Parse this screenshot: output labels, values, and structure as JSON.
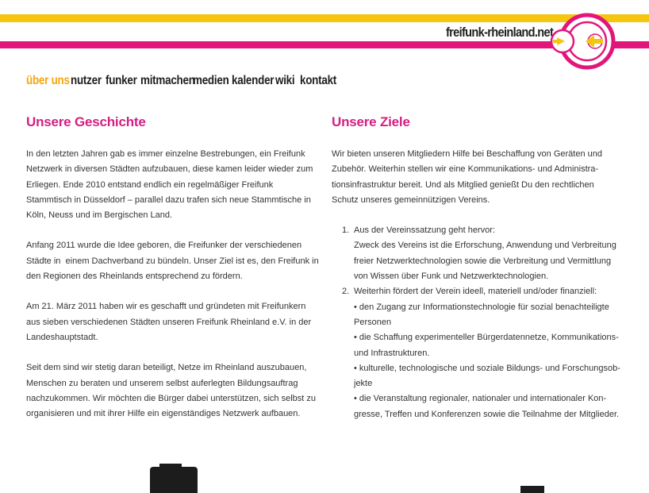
{
  "brand": {
    "name": "freifunk-rheinland.net"
  },
  "colors": {
    "accent": "#d41f82",
    "yellow": "#f5c50f",
    "magenta": "#e3157a",
    "active_nav": "#f3a712"
  },
  "nav": {
    "items": [
      {
        "label": "über uns",
        "active": true
      },
      {
        "label": "nutzer"
      },
      {
        "label": "funker"
      },
      {
        "label": "mitmachen"
      },
      {
        "label": "medien"
      },
      {
        "label": "kalender"
      },
      {
        "label": "wiki"
      },
      {
        "label": "kontakt"
      }
    ]
  },
  "history": {
    "title": "Unsere Geschichte",
    "p1": [
      "In den letzten Jahren gab es immer einzelne Bestrebungen, ein Freifunk",
      "Netzwerk in diversen Städten aufzubauen, diese kamen leider wieder zum",
      "Erliegen. Ende 2010 entstand endlich ein regelmäßiger Freifunk",
      "Stammtisch in Düsseldorf – parallel dazu trafen sich neue Stammtische in",
      "Köln, Neuss und im Bergischen Land."
    ],
    "p2": [
      "Anfang 2011 wurde die Idee geboren, die Freifunker der verschiedenen",
      "Städte in  einem Dachverband zu bündeln. Unser Ziel ist es, den Freifunk in",
      "den Regionen des Rheinlands entsprechend zu fördern."
    ],
    "p3": [
      "Am 21. März 2011 haben wir es geschafft und gründeten mit Freifunkern",
      "aus sieben verschiedenen Städten unseren Freifunk Rheinland e.V. in der",
      "Landeshauptstadt."
    ],
    "p4": [
      "Seit dem sind wir stetig daran beteiligt, Netze im Rheinland auszubauen,",
      "Menschen zu beraten und unserem selbst auferlegten Bildungsauftrag",
      "nachzukommen. Wir möchten die Bürger dabei unterstützen, sich selbst zu",
      "organisieren und mit ihrer Hilfe ein eigenständiges Netzwerk aufbauen."
    ]
  },
  "goals": {
    "title": "Unsere Ziele",
    "intro": [
      "Wir bieten unseren Mitgliedern Hilfe bei Beschaffung von Geräten und",
      "Zubehör. Weiterhin stellen wir eine Kommunikations- und Administra-",
      "tionsinfrastruktur bereit. Und als Mitglied genießt Du den rechtlichen",
      "Schutz unseres gemeinnützigen Vereins."
    ],
    "item1": {
      "num": "1.",
      "lines": [
        "Aus der Vereinssatzung geht hervor:",
        "Zweck des Vereins ist die Erforschung, Anwendung und Verbreitung",
        "freier Netzwerktechnologien sowie die Verbreitung und Vermittlung",
        "von Wissen über Funk und Netzwerktechnologien."
      ]
    },
    "item2": {
      "num": "2.",
      "lines": [
        "Weiterhin fördert der Verein ideell, materiell und/oder finanziell:",
        "• den Zugang zur Informationstechnologie für sozial benachteiligte",
        "Personen",
        "• die Schaffung experimenteller Bürgerdatennetze, Kommunikations-",
        "und Infrastrukturen.",
        "• kulturelle, technologische und soziale Bildungs- und Forschungsob-",
        "jekte",
        "• die Veranstaltung regionaler, nationaler und internationaler Kon-",
        "gresse, Treffen und Konferenzen sowie die Teilnahme der Mitglieder."
      ]
    }
  }
}
